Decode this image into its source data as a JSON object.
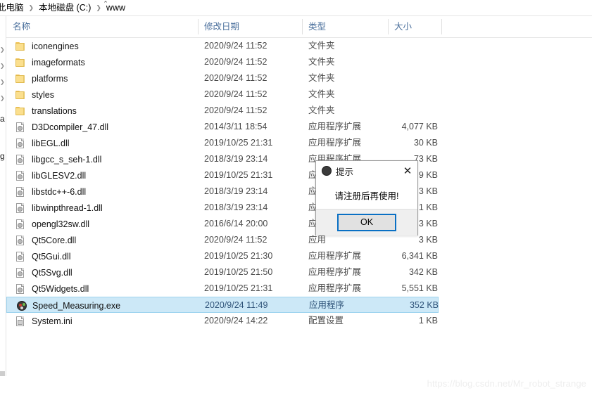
{
  "breadcrumb": {
    "items": [
      "此电脑",
      "本地磁盘 (C:)",
      "www"
    ],
    "separator": "❯"
  },
  "columns": {
    "name": "名称",
    "date_modified": "修改日期",
    "type": "类型",
    "size": "大小",
    "sort_indicator": "⌃"
  },
  "nav_pane": {
    "fragments": [
      "a",
      "g"
    ],
    "chevron": "❯"
  },
  "files": [
    {
      "name": "iconengines",
      "date": "2020/9/24 11:52",
      "type": "文件夹",
      "size": "",
      "icon": "folder",
      "selected": false
    },
    {
      "name": "imageformats",
      "date": "2020/9/24 11:52",
      "type": "文件夹",
      "size": "",
      "icon": "folder",
      "selected": false
    },
    {
      "name": "platforms",
      "date": "2020/9/24 11:52",
      "type": "文件夹",
      "size": "",
      "icon": "folder",
      "selected": false
    },
    {
      "name": "styles",
      "date": "2020/9/24 11:52",
      "type": "文件夹",
      "size": "",
      "icon": "folder",
      "selected": false
    },
    {
      "name": "translations",
      "date": "2020/9/24 11:52",
      "type": "文件夹",
      "size": "",
      "icon": "folder",
      "selected": false
    },
    {
      "name": "D3Dcompiler_47.dll",
      "date": "2014/3/11 18:54",
      "type": "应用程序扩展",
      "size": "4,077 KB",
      "icon": "dll",
      "selected": false
    },
    {
      "name": "libEGL.dll",
      "date": "2019/10/25 21:31",
      "type": "应用程序扩展",
      "size": "30 KB",
      "icon": "dll",
      "selected": false
    },
    {
      "name": "libgcc_s_seh-1.dll",
      "date": "2018/3/19 23:14",
      "type": "应用程序扩展",
      "size": "73 KB",
      "icon": "dll",
      "selected": false
    },
    {
      "name": "libGLESV2.dll",
      "date": "2019/10/25 21:31",
      "type": "应用",
      "size": "9 KB",
      "icon": "dll",
      "selected": false
    },
    {
      "name": "libstdc++-6.dll",
      "date": "2018/3/19 23:14",
      "type": "应用",
      "size": "3 KB",
      "icon": "dll",
      "selected": false
    },
    {
      "name": "libwinpthread-1.dll",
      "date": "2018/3/19 23:14",
      "type": "应用",
      "size": "1 KB",
      "icon": "dll",
      "selected": false
    },
    {
      "name": "opengl32sw.dll",
      "date": "2016/6/14 20:00",
      "type": "应用",
      "size": "3 KB",
      "icon": "dll",
      "selected": false
    },
    {
      "name": "Qt5Core.dll",
      "date": "2020/9/24 11:52",
      "type": "应用",
      "size": "3 KB",
      "icon": "dll",
      "selected": false
    },
    {
      "name": "Qt5Gui.dll",
      "date": "2019/10/25 21:30",
      "type": "应用程序扩展",
      "size": "6,341 KB",
      "icon": "dll",
      "selected": false
    },
    {
      "name": "Qt5Svg.dll",
      "date": "2019/10/25 21:50",
      "type": "应用程序扩展",
      "size": "342 KB",
      "icon": "dll",
      "selected": false
    },
    {
      "name": "Qt5Widgets.dll",
      "date": "2019/10/25 21:31",
      "type": "应用程序扩展",
      "size": "5,551 KB",
      "icon": "dll",
      "selected": false
    },
    {
      "name": "Speed_Measuring.exe",
      "date": "2020/9/24 11:49",
      "type": "应用程序",
      "size": "352 KB",
      "icon": "exe",
      "selected": true
    },
    {
      "name": "System.ini",
      "date": "2020/9/24 14:22",
      "type": "配置设置",
      "size": "1 KB",
      "icon": "ini",
      "selected": false
    }
  ],
  "dialog": {
    "title": "提示",
    "message": "请注册后再使用!",
    "ok_label": "OK",
    "close_label": "✕",
    "accent_color": "#0a70c4"
  },
  "watermark": {
    "text": "https://blog.csdn.net/Mr_robot_strange"
  }
}
